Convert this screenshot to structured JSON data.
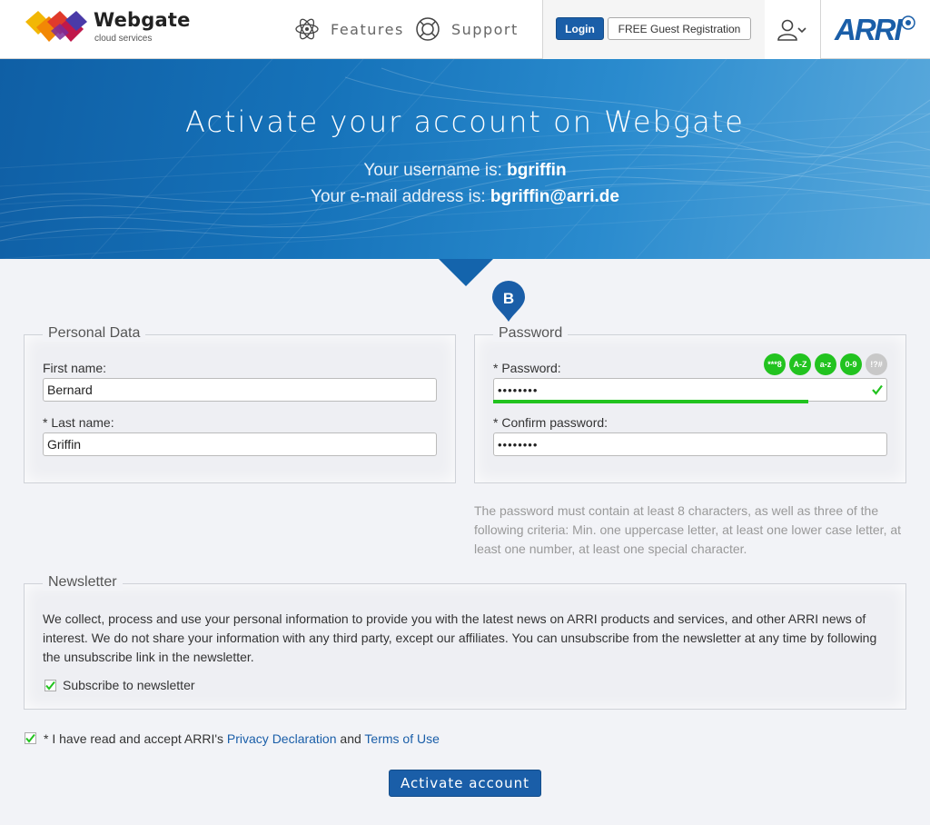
{
  "header": {
    "logo_name": "Webgate",
    "logo_sub": "cloud services",
    "nav": [
      {
        "label": "Features",
        "icon": "atom-icon"
      },
      {
        "label": "Support",
        "icon": "lifebuoy-icon"
      }
    ],
    "login_label": "Login",
    "guest_label": "FREE Guest Registration",
    "brand": "ARRI"
  },
  "hero": {
    "title": "Activate your account on Webgate",
    "username_prefix": "Your username is: ",
    "username": "bgriffin",
    "email_prefix": "Your e-mail address is: ",
    "email": "bgriffin@arri.de",
    "pin_letter": "B"
  },
  "personal": {
    "legend": "Personal Data",
    "first_name_label": "First name:",
    "first_name_value": "Bernard",
    "last_name_label": "* Last name:",
    "last_name_value": "Griffin"
  },
  "password": {
    "legend": "Password",
    "password_label": "* Password:",
    "password_value": "••••••••",
    "confirm_label": "* Confirm password:",
    "confirm_value": "••••••••",
    "criteria": [
      {
        "label": "***8",
        "met": true
      },
      {
        "label": "A-Z",
        "met": true
      },
      {
        "label": "a-z",
        "met": true
      },
      {
        "label": "0-9",
        "met": true
      },
      {
        "label": "!?#",
        "met": false
      }
    ],
    "strength_fraction": 0.8,
    "hint": "The password must contain at least 8 characters, as well as three of the following criteria: Min. one uppercase letter, at least one lower case letter, at least one number, at least one special character."
  },
  "newsletter": {
    "legend": "Newsletter",
    "text": "We collect, process and use your personal information to provide you with the latest news on ARRI products and services, and other ARRI news of interest. We do not share your information with any third party, except our affiliates. You can unsubscribe from the newsletter at any time by following the unsubscribe link in the newsletter.",
    "subscribe_label": "Subscribe to newsletter",
    "subscribe_checked": true
  },
  "terms": {
    "prefix": "* I have read and accept ARRI's ",
    "privacy_link": "Privacy Declaration",
    "and": " and ",
    "terms_link": "Terms of Use",
    "checked": true
  },
  "activate_label": "Activate account",
  "colors": {
    "accent": "#1a5ea8",
    "success": "#22c31f"
  }
}
